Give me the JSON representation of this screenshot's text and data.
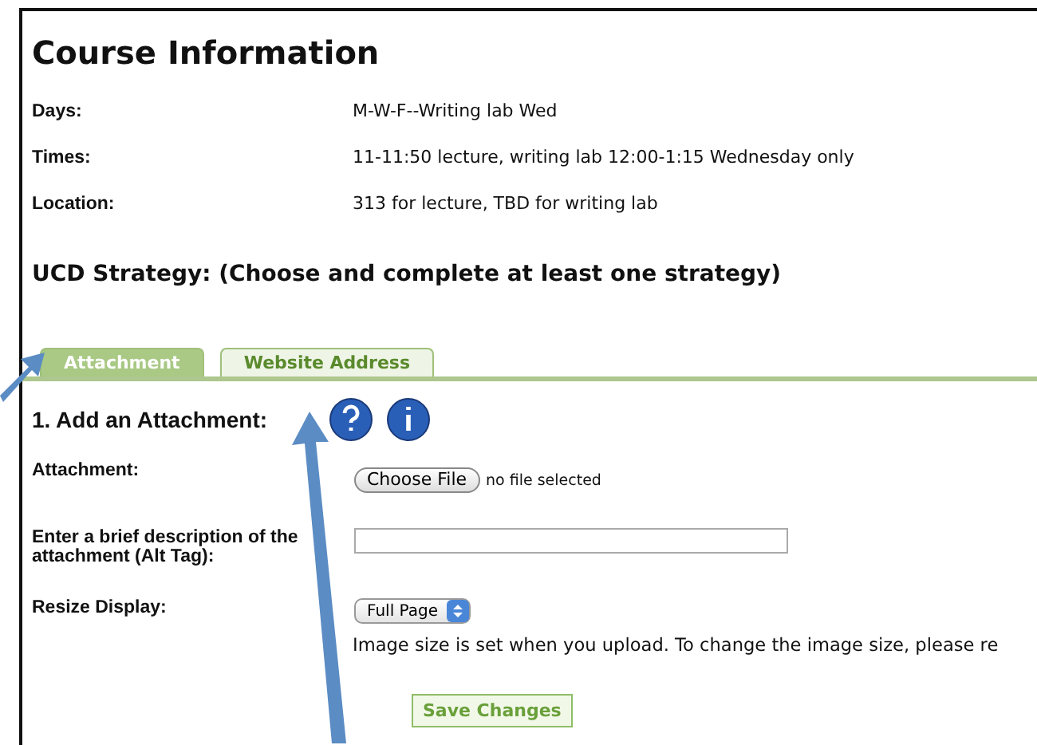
{
  "title": "Course Information",
  "info_rows": [
    {
      "label": "Days:",
      "value": "M-W-F--Writing lab Wed"
    },
    {
      "label": "Times:",
      "value": "11-11:50 lecture, writing lab 12:00-1:15 Wednesday only"
    },
    {
      "label": "Location:",
      "value": "313 for lecture, TBD for writing lab"
    }
  ],
  "strategy_heading": "UCD Strategy: (Choose and complete at least one strategy)",
  "tabs": [
    {
      "label": "Attachment",
      "selected": true
    },
    {
      "label": "Website Address",
      "selected": false
    }
  ],
  "section_title": "1. Add an Attachment:",
  "attachment": {
    "label": "Attachment:",
    "button": "Choose File",
    "status": "no file selected"
  },
  "description": {
    "label": "Enter a brief description of the attachment (Alt Tag):"
  },
  "resize": {
    "label": "Resize Display:",
    "value": "Full Page",
    "note": "Image size is set when you upload. To change the image size, please re"
  },
  "save_button": "Save Changes"
}
